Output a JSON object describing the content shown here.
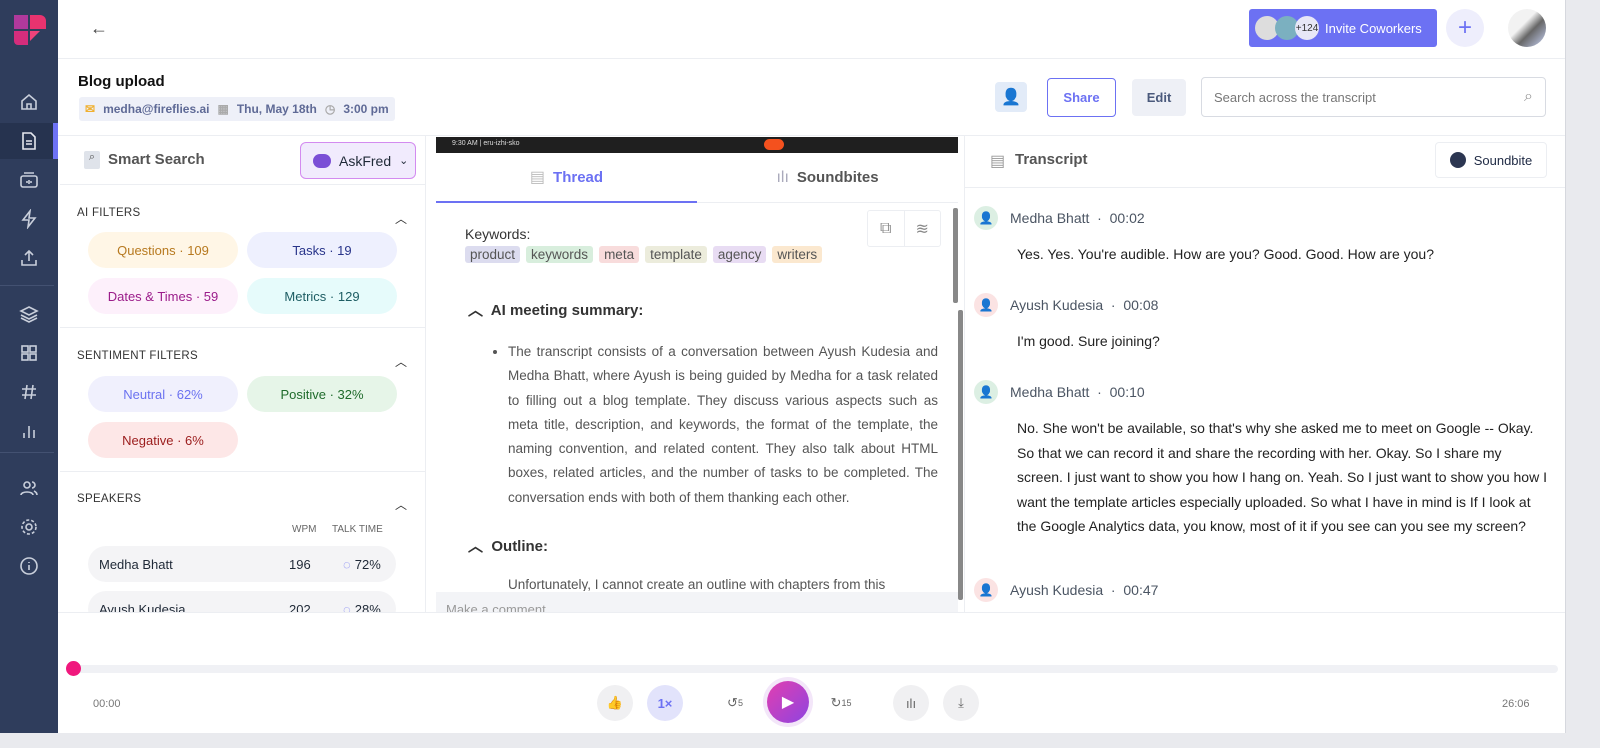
{
  "header": {
    "back_icon": "arrow-left-icon",
    "title": "Blog upload",
    "email": "medha@fireflies.ai",
    "date": "Thu, May 18th",
    "time": "3:00 pm",
    "invite_label": "Invite Coworkers",
    "invite_count": "+124",
    "share_label": "Share",
    "edit_label": "Edit",
    "search_placeholder": "Search across the transcript"
  },
  "sidebar": {
    "items": [
      "home-icon",
      "notebook-icon",
      "meetings-icon",
      "integrations-icon",
      "upload-icon",
      "layers-icon",
      "apps-icon",
      "channels-icon",
      "analytics-icon",
      "team-icon",
      "settings-icon",
      "info-icon"
    ]
  },
  "left": {
    "smart_search": "Smart Search",
    "askfred": "AskFred",
    "ai_filters_title": "AI FILTERS",
    "ai_filters": [
      {
        "label": "Questions · 109",
        "bg": "#fff6e6",
        "fg": "#b7791f"
      },
      {
        "label": "Tasks · 19",
        "bg": "#eef0fe",
        "fg": "#28348a"
      },
      {
        "label": "Dates & Times · 59",
        "bg": "#fdf0fb",
        "fg": "#9b1c8a"
      },
      {
        "label": "Metrics · 129",
        "bg": "#e6fbfb",
        "fg": "#1d5d63"
      }
    ],
    "sentiment_title": "SENTIMENT FILTERS",
    "sentiments": [
      {
        "label": "Neutral · 62%",
        "bg": "#f0f0fd",
        "fg": "#6b72f0"
      },
      {
        "label": "Positive · 32%",
        "bg": "#e6f5e8",
        "fg": "#1f6b2b"
      },
      {
        "label": "Negative · 6%",
        "bg": "#fde7e7",
        "fg": "#9b1c1c"
      }
    ],
    "speakers_title": "SPEAKERS",
    "wpm_header": "WPM",
    "talk_header": "TALK TIME",
    "speakers": [
      {
        "name": "Medha Bhatt",
        "wpm": "196",
        "talk": "72%",
        "talk_fraction": 0.72
      },
      {
        "name": "Ayush Kudesia",
        "wpm": "202",
        "talk": "28%",
        "talk_fraction": 0.28
      }
    ]
  },
  "middle": {
    "video_time": "9:30 AM  |  eru-izhi-sko",
    "tab_thread": "Thread",
    "tab_soundbites": "Soundbites",
    "keywords_label": "Keywords:",
    "keywords": [
      {
        "text": "product",
        "bg": "#dcdcef"
      },
      {
        "text": "keywords",
        "bg": "#d8eedd"
      },
      {
        "text": "meta",
        "bg": "#f8dcdc"
      },
      {
        "text": "template",
        "bg": "#ececdc"
      },
      {
        "text": "agency",
        "bg": "#e8dcf3"
      },
      {
        "text": "writers",
        "bg": "#fbe8cf"
      }
    ],
    "summary_title": "AI meeting summary:",
    "summary": "The transcript consists of a conversation between Ayush Kudesia and Medha Bhatt, where Ayush is being guided by Medha for a task related to filling out a blog template. They discuss various aspects such as meta title, description, and keywords, the format of the template, the naming convention, and related content. They also talk about HTML boxes, related articles, and the number of tasks to be completed. The conversation ends with both of them thanking each other.",
    "outline_title": "Outline:",
    "outline": "Unfortunately, I cannot create an outline with chapters from this",
    "comment_placeholder": "Make a comment"
  },
  "transcript": {
    "title": "Transcript",
    "soundbite_label": "Soundbite",
    "entries": [
      {
        "speaker": "Medha Bhatt",
        "time": "00:02",
        "text": "Yes. Yes. You're audible. How are you? Good. Good. How are you?",
        "color": "green"
      },
      {
        "speaker": "Ayush Kudesia",
        "time": "00:08",
        "text": "I'm good. Sure joining?",
        "color": "red"
      },
      {
        "speaker": "Medha Bhatt",
        "time": "00:10",
        "text": "No. She won't be available, so that's why she asked me to meet on Google -- Okay. So that we can record it and share the recording with her. Okay. So I share my screen. I just want to show you how I hang on. Yeah. So I just want to show you how I want the template articles especially uploaded. So what I have in mind is If I look at the Google Analytics data, you know, most of it if you see can you see my screen?",
        "color": "green"
      },
      {
        "speaker": "Ayush Kudesia",
        "time": "00:47",
        "text": "",
        "color": "red"
      }
    ]
  },
  "player": {
    "current": "00:00",
    "duration": "26:06",
    "speed": "1×",
    "rewind": "5",
    "forward": "15",
    "progress": 0
  }
}
